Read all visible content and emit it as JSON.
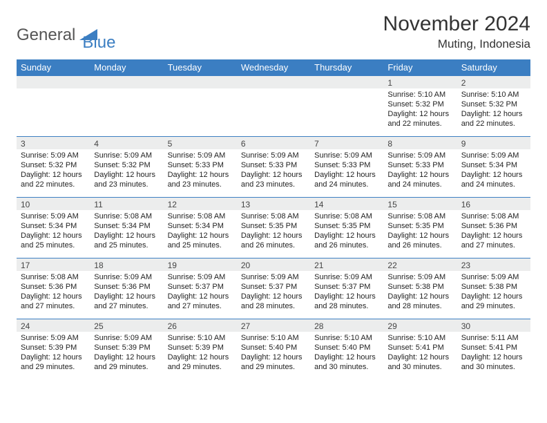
{
  "brand": {
    "part1": "General",
    "part2": "Blue"
  },
  "title": "November 2024",
  "location": "Muting, Indonesia",
  "weekdays": [
    "Sunday",
    "Monday",
    "Tuesday",
    "Wednesday",
    "Thursday",
    "Friday",
    "Saturday"
  ],
  "chart_data": {
    "type": "table",
    "title": "November 2024 Sunrise/Sunset — Muting, Indonesia",
    "columns": [
      "day",
      "sunrise",
      "sunset",
      "daylight"
    ],
    "rows": [
      {
        "day": 1,
        "sunrise": "5:10 AM",
        "sunset": "5:32 PM",
        "daylight": "12 hours and 22 minutes."
      },
      {
        "day": 2,
        "sunrise": "5:10 AM",
        "sunset": "5:32 PM",
        "daylight": "12 hours and 22 minutes."
      },
      {
        "day": 3,
        "sunrise": "5:09 AM",
        "sunset": "5:32 PM",
        "daylight": "12 hours and 22 minutes."
      },
      {
        "day": 4,
        "sunrise": "5:09 AM",
        "sunset": "5:32 PM",
        "daylight": "12 hours and 23 minutes."
      },
      {
        "day": 5,
        "sunrise": "5:09 AM",
        "sunset": "5:33 PM",
        "daylight": "12 hours and 23 minutes."
      },
      {
        "day": 6,
        "sunrise": "5:09 AM",
        "sunset": "5:33 PM",
        "daylight": "12 hours and 23 minutes."
      },
      {
        "day": 7,
        "sunrise": "5:09 AM",
        "sunset": "5:33 PM",
        "daylight": "12 hours and 24 minutes."
      },
      {
        "day": 8,
        "sunrise": "5:09 AM",
        "sunset": "5:33 PM",
        "daylight": "12 hours and 24 minutes."
      },
      {
        "day": 9,
        "sunrise": "5:09 AM",
        "sunset": "5:34 PM",
        "daylight": "12 hours and 24 minutes."
      },
      {
        "day": 10,
        "sunrise": "5:09 AM",
        "sunset": "5:34 PM",
        "daylight": "12 hours and 25 minutes."
      },
      {
        "day": 11,
        "sunrise": "5:08 AM",
        "sunset": "5:34 PM",
        "daylight": "12 hours and 25 minutes."
      },
      {
        "day": 12,
        "sunrise": "5:08 AM",
        "sunset": "5:34 PM",
        "daylight": "12 hours and 25 minutes."
      },
      {
        "day": 13,
        "sunrise": "5:08 AM",
        "sunset": "5:35 PM",
        "daylight": "12 hours and 26 minutes."
      },
      {
        "day": 14,
        "sunrise": "5:08 AM",
        "sunset": "5:35 PM",
        "daylight": "12 hours and 26 minutes."
      },
      {
        "day": 15,
        "sunrise": "5:08 AM",
        "sunset": "5:35 PM",
        "daylight": "12 hours and 26 minutes."
      },
      {
        "day": 16,
        "sunrise": "5:08 AM",
        "sunset": "5:36 PM",
        "daylight": "12 hours and 27 minutes."
      },
      {
        "day": 17,
        "sunrise": "5:08 AM",
        "sunset": "5:36 PM",
        "daylight": "12 hours and 27 minutes."
      },
      {
        "day": 18,
        "sunrise": "5:09 AM",
        "sunset": "5:36 PM",
        "daylight": "12 hours and 27 minutes."
      },
      {
        "day": 19,
        "sunrise": "5:09 AM",
        "sunset": "5:37 PM",
        "daylight": "12 hours and 27 minutes."
      },
      {
        "day": 20,
        "sunrise": "5:09 AM",
        "sunset": "5:37 PM",
        "daylight": "12 hours and 28 minutes."
      },
      {
        "day": 21,
        "sunrise": "5:09 AM",
        "sunset": "5:37 PM",
        "daylight": "12 hours and 28 minutes."
      },
      {
        "day": 22,
        "sunrise": "5:09 AM",
        "sunset": "5:38 PM",
        "daylight": "12 hours and 28 minutes."
      },
      {
        "day": 23,
        "sunrise": "5:09 AM",
        "sunset": "5:38 PM",
        "daylight": "12 hours and 29 minutes."
      },
      {
        "day": 24,
        "sunrise": "5:09 AM",
        "sunset": "5:39 PM",
        "daylight": "12 hours and 29 minutes."
      },
      {
        "day": 25,
        "sunrise": "5:09 AM",
        "sunset": "5:39 PM",
        "daylight": "12 hours and 29 minutes."
      },
      {
        "day": 26,
        "sunrise": "5:10 AM",
        "sunset": "5:39 PM",
        "daylight": "12 hours and 29 minutes."
      },
      {
        "day": 27,
        "sunrise": "5:10 AM",
        "sunset": "5:40 PM",
        "daylight": "12 hours and 29 minutes."
      },
      {
        "day": 28,
        "sunrise": "5:10 AM",
        "sunset": "5:40 PM",
        "daylight": "12 hours and 30 minutes."
      },
      {
        "day": 29,
        "sunrise": "5:10 AM",
        "sunset": "5:41 PM",
        "daylight": "12 hours and 30 minutes."
      },
      {
        "day": 30,
        "sunrise": "5:11 AM",
        "sunset": "5:41 PM",
        "daylight": "12 hours and 30 minutes."
      }
    ]
  },
  "labels": {
    "sunrise": "Sunrise:",
    "sunset": "Sunset:",
    "daylight": "Daylight:"
  },
  "layout": {
    "leading_blanks": 5
  }
}
